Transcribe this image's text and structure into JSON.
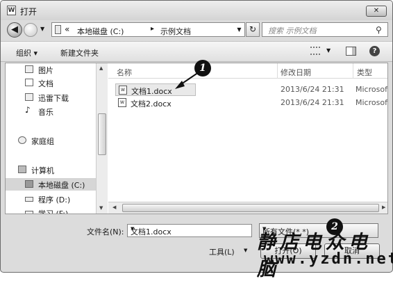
{
  "window": {
    "title": "打开",
    "app_icon": "W",
    "close": "✕"
  },
  "nav": {
    "path_chevron": "«",
    "breadcrumb": [
      "本地磁盘 (C:)",
      "示例文档"
    ],
    "separator": "▸",
    "search_placeholder": "搜索 示例文档"
  },
  "toolbar": {
    "organize": "组织 ▾",
    "new_folder": "新建文件夹"
  },
  "sidebar": {
    "items": [
      "图片",
      "文档",
      "迅雷下载",
      "音乐",
      "家庭组",
      "计算机",
      "本地磁盘 (C:)",
      "程序 (D:)",
      "学习 (F:)"
    ],
    "selected": "本地磁盘 (C:)"
  },
  "columns": {
    "name": "名称",
    "date": "修改日期",
    "type": "类型"
  },
  "files": [
    {
      "name": "文档1.docx",
      "date": "2013/6/24 21:31",
      "type": "Microsof"
    },
    {
      "name": "文档2.docx",
      "date": "2013/6/24 21:31",
      "type": "Microsof"
    }
  ],
  "footer": {
    "filename_label": "文件名(N):",
    "filename_value": "文档1.docx",
    "filter": "所有文件(*.*)",
    "tools": "工具(L)",
    "open": "打开(O)",
    "cancel": "取消"
  },
  "callouts": [
    "1",
    "2"
  ],
  "watermark": {
    "line1": "静店电众电脑",
    "line2": "www.yzdn.net"
  }
}
